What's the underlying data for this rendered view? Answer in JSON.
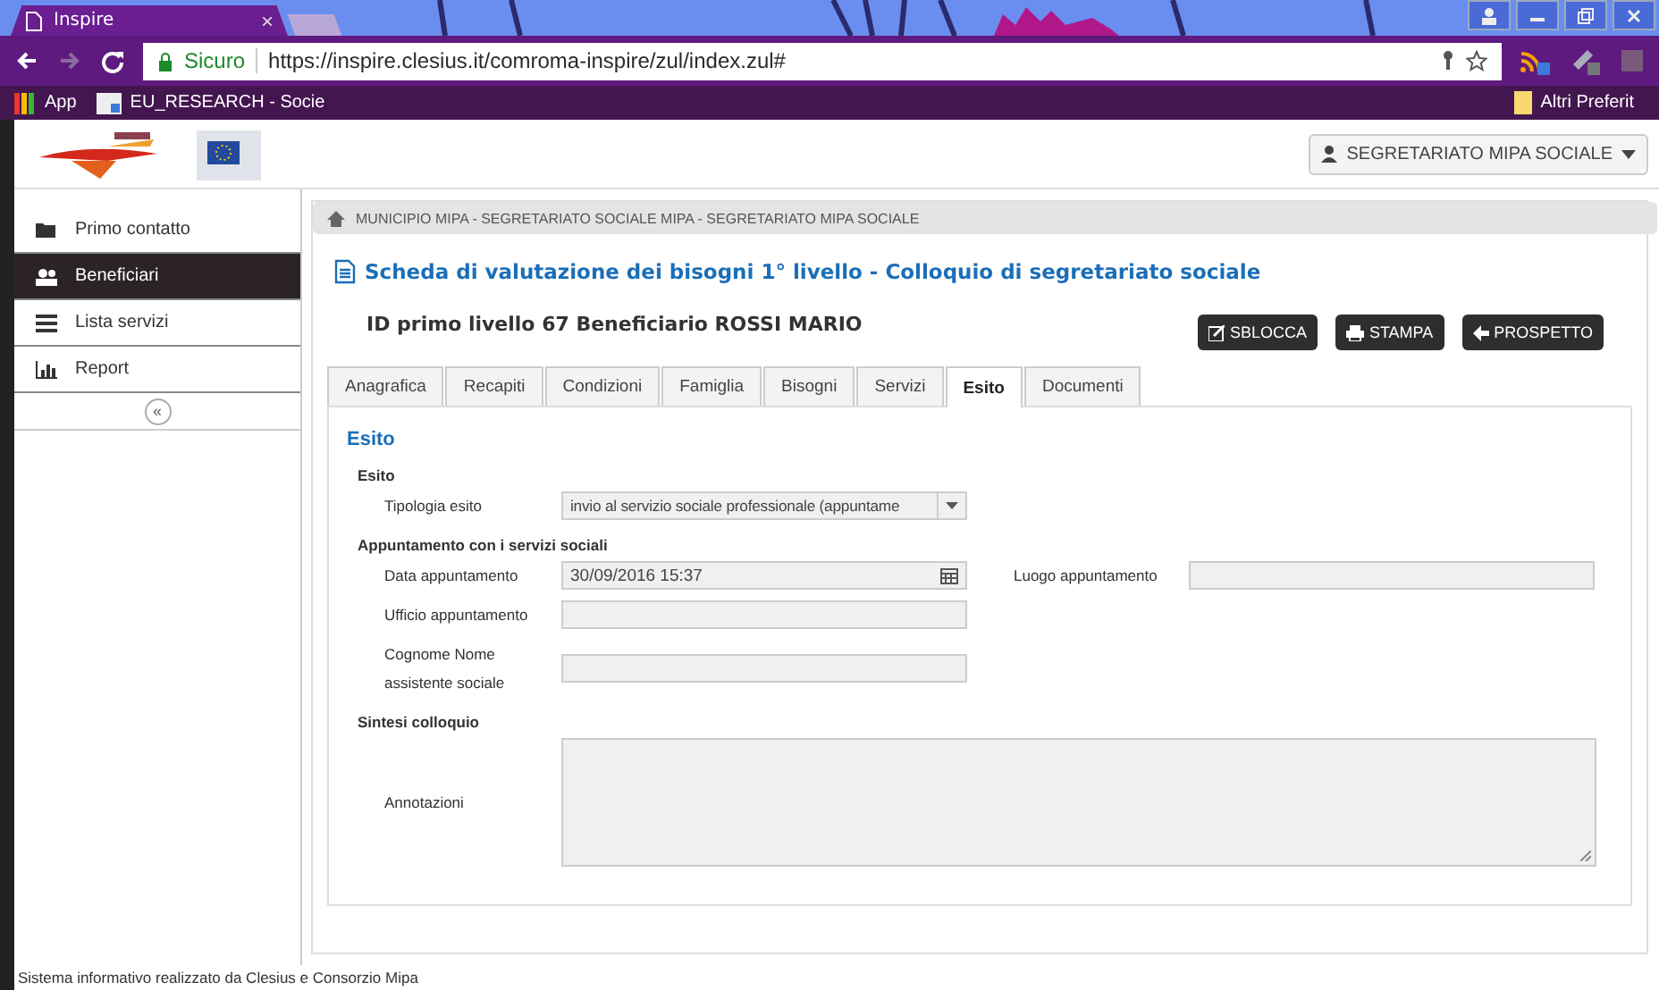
{
  "browser": {
    "tab_title": "Inspire",
    "tab_close": "×",
    "secure_label": "Sicuro",
    "url": "https://inspire.clesius.it/comroma-inspire/zul/index.zul#",
    "bookmarks": [
      "App",
      "EU_RESEARCH - Socie"
    ],
    "other_bookmarks": "Altri Preferit"
  },
  "header": {
    "user_menu": "SEGRETARIATO MIPA SOCIALE"
  },
  "sidebar": {
    "items": [
      {
        "label": "Primo contatto",
        "kind": "folder",
        "selected": false
      },
      {
        "label": "Beneficiari",
        "kind": "users",
        "selected": true
      },
      {
        "label": "Lista servizi",
        "kind": "list",
        "selected": false
      },
      {
        "label": "Report",
        "kind": "chart",
        "selected": false
      }
    ],
    "collapse": "«"
  },
  "breadcrumb": "MUNICIPIO MIPA - SEGRETARIATO SOCIALE MIPA - SEGRETARIATO MIPA SOCIALE",
  "page_title": "Scheda di valutazione dei bisogni 1° livello - Colloquio di segretariato sociale",
  "record_heading": "ID primo livello 67 Beneficiario ROSSI MARIO",
  "actions": [
    {
      "label": "SBLOCCA",
      "kind": "edit"
    },
    {
      "label": "STAMPA",
      "kind": "print"
    },
    {
      "label": "PROSPETTO",
      "kind": "back"
    }
  ],
  "tabs": [
    {
      "label": "Anagrafica",
      "selected": false
    },
    {
      "label": "Recapiti",
      "selected": false
    },
    {
      "label": "Condizioni",
      "selected": false
    },
    {
      "label": "Famiglia",
      "selected": false
    },
    {
      "label": "Bisogni",
      "selected": false
    },
    {
      "label": "Servizi",
      "selected": false
    },
    {
      "label": "Esito",
      "selected": true
    },
    {
      "label": "Documenti",
      "selected": false
    }
  ],
  "panel": {
    "title": "Esito",
    "groups": [
      {
        "title": "Esito",
        "rows": [
          [
            {
              "label": "Tipologia esito",
              "kind": "select",
              "value": "invio al servizio sociale professionale (appuntame"
            }
          ]
        ]
      },
      {
        "title": "Appuntamento con i servizi sociali",
        "rows": [
          [
            {
              "label": "Data appuntamento",
              "kind": "date",
              "value": "30/09/2016 15:37"
            },
            {
              "label": "Luogo appuntamento",
              "kind": "text"
            }
          ],
          [
            {
              "label": "Ufficio appuntamento",
              "kind": "text"
            }
          ],
          [
            {
              "label": "Cognome Nome assistente sociale",
              "kind": "text"
            }
          ]
        ]
      },
      {
        "title": "Sintesi colloquio",
        "rows": [
          [
            {
              "label": "Annotazioni",
              "kind": "textarea"
            }
          ]
        ]
      }
    ]
  },
  "footer": "Sistema informativo realizzato da Clesius e Consorzio Mipa"
}
